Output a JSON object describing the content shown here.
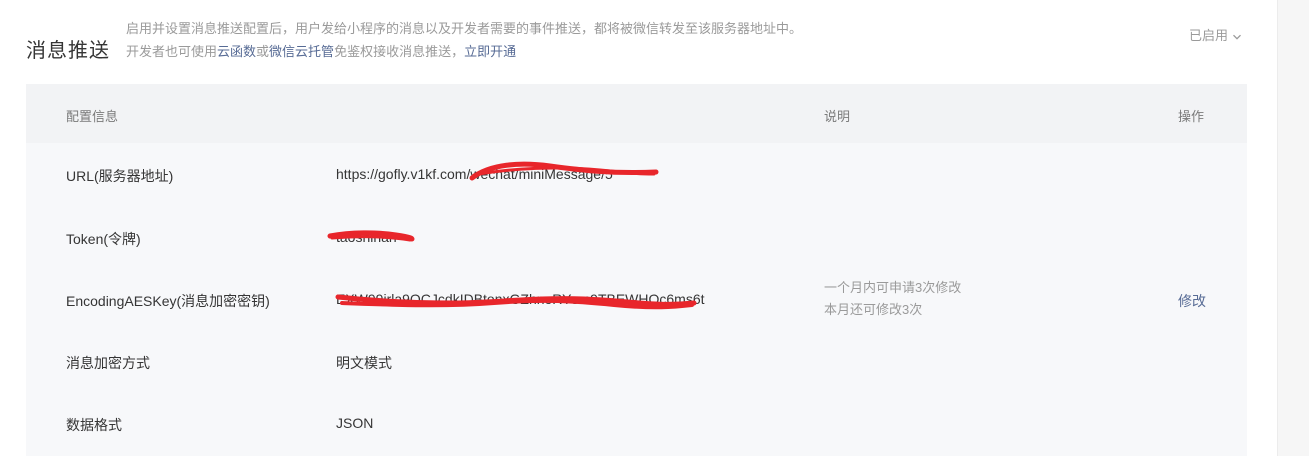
{
  "section": {
    "title": "消息推送"
  },
  "description": {
    "line1": "启用并设置消息推送配置后，用户发给小程序的消息以及开发者需要的事件推送，都将被微信转发至该服务器地址中。",
    "line2_prefix": "开发者也可使用",
    "link_cloud_function": "云函数",
    "or": "或",
    "link_cloud_hosting": "微信云托管",
    "line2_suffix": "免鉴权接收消息推送，",
    "link_enable_now": "立即开通"
  },
  "status": {
    "label": "已启用",
    "icon": "chevron-down-icon"
  },
  "table": {
    "headers": {
      "config": "配置信息",
      "note": "说明",
      "action": "操作"
    },
    "rows": [
      {
        "label": "URL(服务器地址)",
        "value": "https://gofly.v1kf.com/wechat/miniMessage/5"
      },
      {
        "label": "Token(令牌)",
        "value": "taoshihan"
      },
      {
        "label": "EncodingAESKey(消息加密密钥)",
        "value": "EXW99irla9OCJcdkIDBtonxGZhnoRYsm9TBEWHQc6ms6t",
        "note1": "一个月内可申请3次修改",
        "note2": "本月还可修改3次",
        "action": "修改"
      },
      {
        "label": "消息加密方式",
        "value": "明文模式"
      },
      {
        "label": "数据格式",
        "value": "JSON"
      }
    ]
  },
  "colors": {
    "link": "#576b95",
    "redaction": "#e8262b",
    "muted": "#9a9a9a"
  }
}
